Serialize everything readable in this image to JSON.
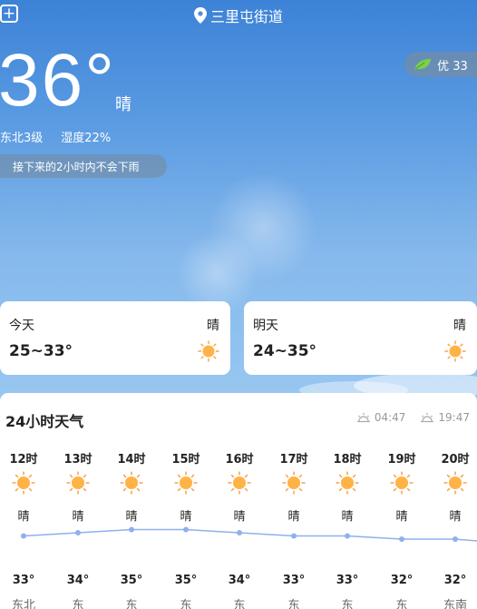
{
  "header": {
    "add_label": "+",
    "location": "三里屯街道",
    "aqi_label": "优 33"
  },
  "current": {
    "temperature": "36°",
    "condition": "晴",
    "wind": "东北3级",
    "humidity": "湿度22%",
    "rain_notice": "接下来的2小时内不会下雨"
  },
  "days": [
    {
      "name": "今天",
      "condition": "晴",
      "range": "25~33°",
      "icon": "sun-icon"
    },
    {
      "name": "明天",
      "condition": "晴",
      "range": "24~35°",
      "icon": "sun-icon"
    }
  ],
  "hourly": {
    "title": "24小时天气",
    "sunrise": "04:47",
    "sunset": "19:47",
    "items": [
      {
        "time": "12时",
        "cond": "晴",
        "temp": "33°",
        "wind": "东北",
        "value": 33
      },
      {
        "time": "13时",
        "cond": "晴",
        "temp": "34°",
        "wind": "东",
        "value": 34
      },
      {
        "time": "14时",
        "cond": "晴",
        "temp": "35°",
        "wind": "东",
        "value": 35
      },
      {
        "time": "15时",
        "cond": "晴",
        "temp": "35°",
        "wind": "东",
        "value": 35
      },
      {
        "time": "16时",
        "cond": "晴",
        "temp": "34°",
        "wind": "东",
        "value": 34
      },
      {
        "time": "17时",
        "cond": "晴",
        "temp": "33°",
        "wind": "东",
        "value": 33
      },
      {
        "time": "18时",
        "cond": "晴",
        "temp": "33°",
        "wind": "东",
        "value": 33
      },
      {
        "time": "19时",
        "cond": "晴",
        "temp": "32°",
        "wind": "东",
        "value": 32
      },
      {
        "time": "20时",
        "cond": "晴",
        "temp": "32°",
        "wind": "东南",
        "value": 32
      }
    ]
  },
  "colors": {
    "sun": "#ffb347",
    "sun_ray": "#f7a24a",
    "curve": "#8fb0ec",
    "aqi_leaf": "#7bd04b"
  }
}
